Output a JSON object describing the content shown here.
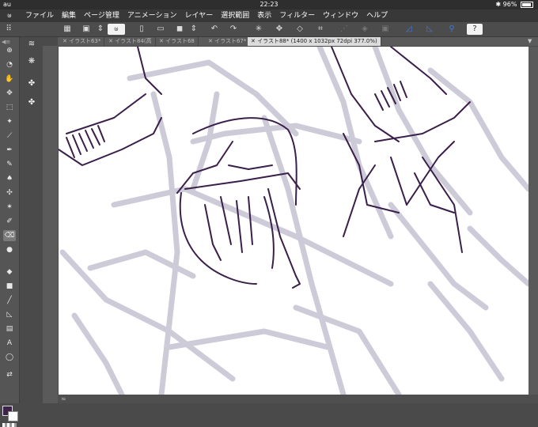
{
  "status": {
    "carrier": "au",
    "time": "22:23",
    "battery": "96%",
    "battery_level": 0.96
  },
  "menu": [
    "ファイル",
    "編集",
    "ページ管理",
    "アニメーション",
    "レイヤー",
    "選択範囲",
    "表示",
    "フィルター",
    "ウィンドウ",
    "ヘルプ"
  ],
  "tabs": [
    {
      "label": "イラスト63*",
      "active": false
    },
    {
      "label": "イラスト84(高",
      "active": false
    },
    {
      "label": "イラスト68",
      "active": false
    },
    {
      "label": "イラスト67*",
      "active": false
    },
    {
      "label": "イラスト88* (1400 x 1032px 72dpi 377.0%)",
      "active": true
    }
  ],
  "tools": {
    "text_tool": "A"
  },
  "colors": {
    "main": "#3b2447",
    "sub": "#ffffff",
    "line_art": "#3a1f4a",
    "sketch": "#c9c6d4"
  }
}
